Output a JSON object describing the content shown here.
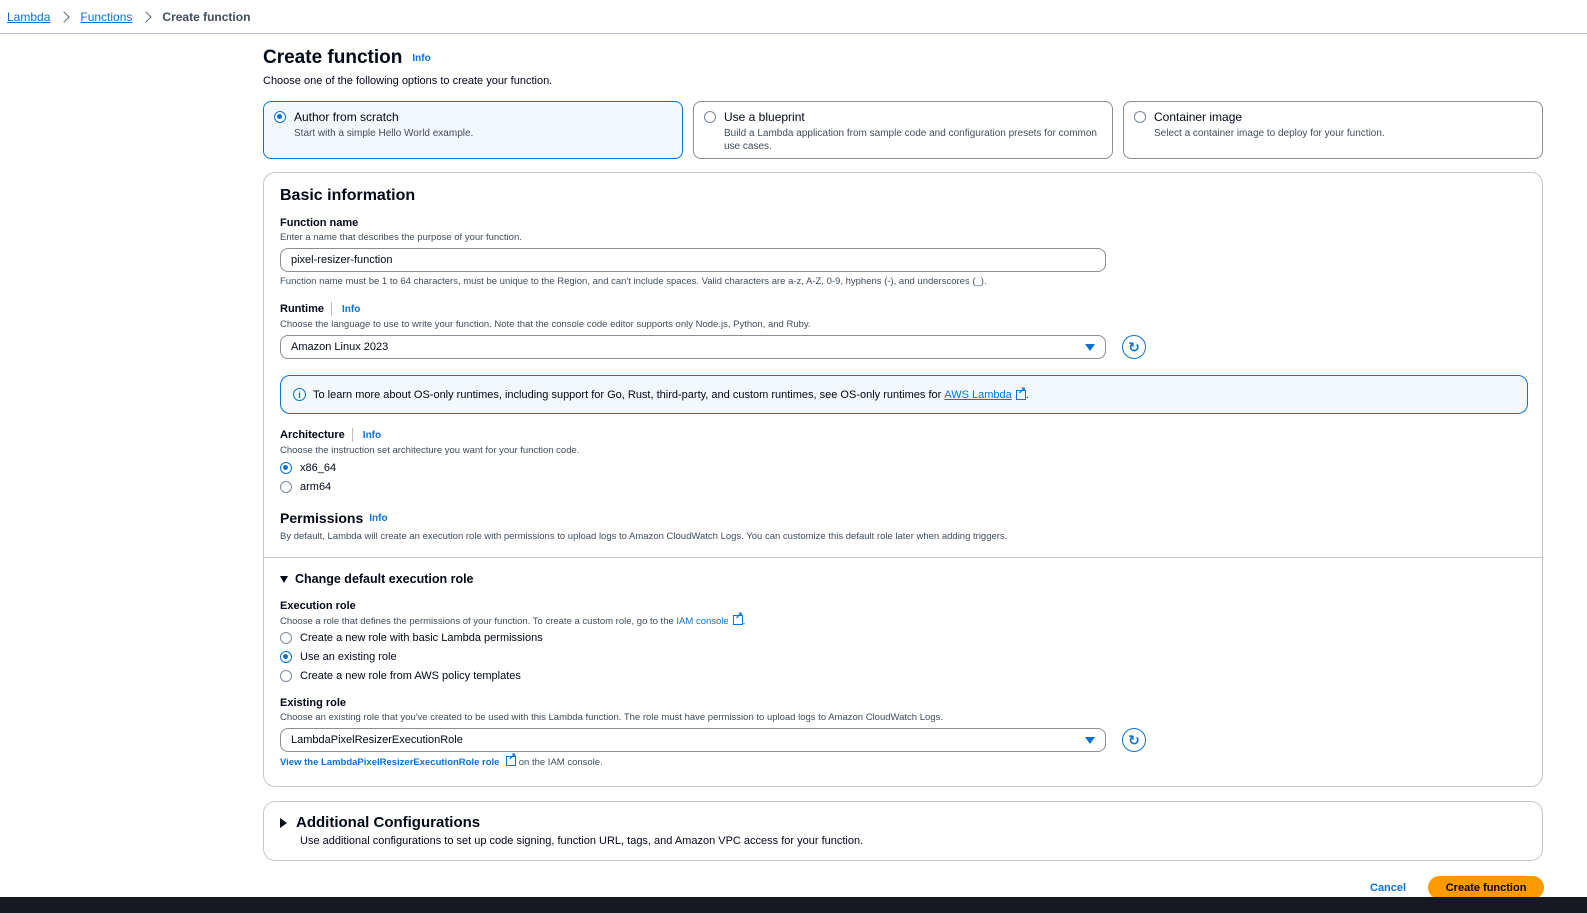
{
  "breadcrumb": {
    "items": [
      "Lambda",
      "Functions"
    ],
    "current": "Create function"
  },
  "header": {
    "title": "Create function",
    "info": "Info",
    "subtitle": "Choose one of the following options to create your function."
  },
  "options": [
    {
      "title": "Author from scratch",
      "desc": "Start with a simple Hello World example.",
      "selected": true
    },
    {
      "title": "Use a blueprint",
      "desc": "Build a Lambda application from sample code and configuration presets for common use cases.",
      "selected": false
    },
    {
      "title": "Container image",
      "desc": "Select a container image to deploy for your function.",
      "selected": false
    }
  ],
  "basic": {
    "title": "Basic information",
    "function_name": {
      "label": "Function name",
      "desc": "Enter a name that describes the purpose of your function.",
      "value": "pixel-resizer-function",
      "constraint": "Function name must be 1 to 64 characters, must be unique to the Region, and can't include spaces. Valid characters are a-z, A-Z, 0-9, hyphens (-), and underscores (_)."
    },
    "runtime": {
      "label": "Runtime",
      "info": "Info",
      "desc": "Choose the language to use to write your function. Note that the console code editor supports only Node.js, Python, and Ruby.",
      "value": "Amazon Linux 2023"
    },
    "alert": {
      "text": "To learn more about OS-only runtimes, including support for Go, Rust, third-party, and custom runtimes, see OS-only runtimes for ",
      "link": "AWS Lambda",
      "end": "."
    },
    "architecture": {
      "label": "Architecture",
      "info": "Info",
      "desc": "Choose the instruction set architecture you want for your function code.",
      "options": [
        "x86_64",
        "arm64"
      ],
      "selected": "x86_64"
    },
    "permissions": {
      "title": "Permissions",
      "info": "Info",
      "desc": "By default, Lambda will create an execution role with permissions to upload logs to Amazon CloudWatch Logs. You can customize this default role later when adding triggers."
    },
    "execution": {
      "expander": "Change default execution role",
      "label": "Execution role",
      "desc": "Choose a role that defines the permissions of your function. To create a custom role, go to the ",
      "desc_link": "IAM console",
      "desc_end": ".",
      "options": [
        "Create a new role with basic Lambda permissions",
        "Use an existing role",
        "Create a new role from AWS policy templates"
      ],
      "selected": "Use an existing role"
    },
    "existing_role": {
      "label": "Existing role",
      "desc": "Choose an existing role that you've created to be used with this Lambda function. The role must have permission to upload logs to Amazon CloudWatch Logs.",
      "value": "LambdaPixelResizerExecutionRole",
      "view_link": "View the LambdaPixelResizerExecutionRole role",
      "view_end": "on the IAM console."
    }
  },
  "additional": {
    "title": "Additional Configurations",
    "desc": "Use additional configurations to set up code signing, function URL, tags, and Amazon VPC access for your function."
  },
  "footer": {
    "cancel": "Cancel",
    "create": "Create function"
  },
  "colors": {
    "accent": "#0972d3",
    "primary_button": "#ff9900"
  }
}
